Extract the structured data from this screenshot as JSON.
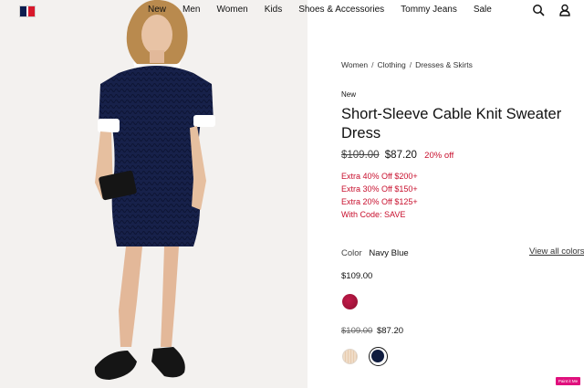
{
  "header": {
    "nav": [
      "New",
      "Men",
      "Women",
      "Kids",
      "Shoes & Accessories",
      "Tommy Jeans",
      "Sale"
    ],
    "icons": {
      "search": "search-icon",
      "account": "user-icon",
      "logo": "flag-logo"
    }
  },
  "product": {
    "breadcrumb": [
      "Women",
      "Clothing",
      "Dresses & Skirts"
    ],
    "badge": "New",
    "title": "Short-Sleeve Cable Knit Sweater Dress",
    "price_original": "$109.00",
    "price_sale": "$87.20",
    "discount": "20% off",
    "promos": [
      "Extra 40% Off $200+",
      "Extra 30% Off $150+",
      "Extra 20% Off $125+",
      "With Code: SAVE"
    ],
    "color_label": "Color",
    "color_value": "Navy Blue",
    "view_all": "View all colors",
    "swatch_group1_price": "$109.00",
    "swatch_group2_price_original": "$109.00",
    "swatch_group2_price_sale": "$87.20",
    "swatches": [
      {
        "name": "red",
        "color": "#b0153f"
      },
      {
        "name": "cream",
        "color": "#ecd5bd"
      },
      {
        "name": "navy",
        "color": "#0f1c3f",
        "selected": true
      }
    ]
  },
  "badge_text": "Paint it Me"
}
